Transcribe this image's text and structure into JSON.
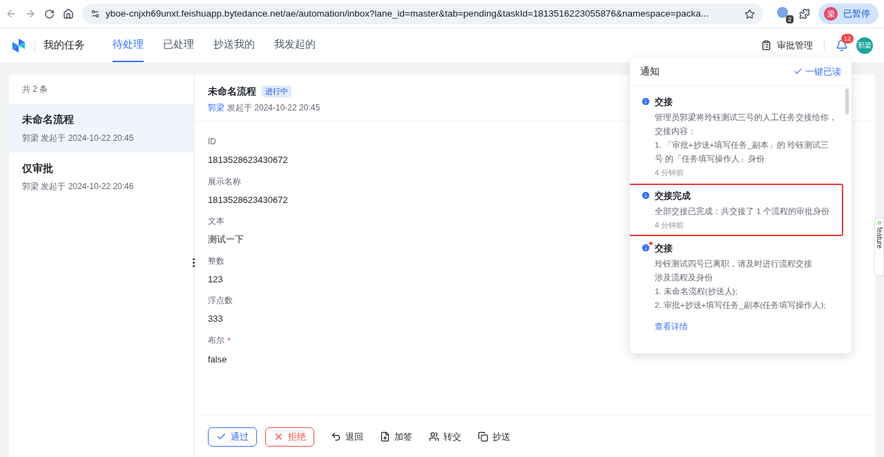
{
  "browser": {
    "url": "yboe-cnjxh69unxt.feishuapp.bytedance.net/ae/automation/inbox?lane_id=master&tab=pending&taskId=1813516223055876&namespace=packa...",
    "extension_badge": "2",
    "profile_avatar": "梁",
    "profile_label": "已暂停"
  },
  "header": {
    "title": "我的任务",
    "tabs": [
      {
        "label": "待处理",
        "selected": true
      },
      {
        "label": "已处理",
        "selected": false
      },
      {
        "label": "抄送我的",
        "selected": false
      },
      {
        "label": "我发起的",
        "selected": false
      }
    ],
    "admin_link": "审批管理",
    "notification_count": "12",
    "avatar": "郭梁"
  },
  "task_list": {
    "count": "共 2 条",
    "items": [
      {
        "title": "未命名流程",
        "meta": "郭梁 发起于 2024-10-22 20:45",
        "selected": true
      },
      {
        "title": "仅审批",
        "meta": "郭梁 发起于 2024-10-22 20:46",
        "selected": false
      }
    ]
  },
  "detail": {
    "title": "未命名流程",
    "status": "进行中",
    "initiator": "郭梁",
    "started": "发起于 2024-10-22 20:45",
    "fields": [
      {
        "label": "ID",
        "value": "1813528623430672"
      },
      {
        "label": "展示名称",
        "value": "1813528623430672"
      },
      {
        "label": "文本",
        "value": "测试一下"
      },
      {
        "label": "整数",
        "value": "123"
      },
      {
        "label": "浮点数",
        "value": "333"
      },
      {
        "label": "布尔",
        "value": "false",
        "required_mark": "*"
      }
    ],
    "actions": [
      {
        "kind": "approve",
        "label": "通过"
      },
      {
        "kind": "reject",
        "label": "拒绝"
      },
      {
        "kind": "return",
        "label": "退回"
      },
      {
        "kind": "addsign",
        "label": "加签"
      },
      {
        "kind": "transfer",
        "label": "转交"
      },
      {
        "kind": "cc",
        "label": "抄送"
      }
    ]
  },
  "notifications": {
    "title": "通知",
    "mark_all_read": "一键已读",
    "items": [
      {
        "title": "交接",
        "lines": [
          "管理员郭梁将玲钰测试三号的人工任务交接给你，",
          "交接内容：",
          "1. 「审批+抄送+填写任务_副本」的 玲钰测试三",
          "号 的「任务填写操作人」身份"
        ],
        "time": "4 分钟前",
        "unread": false,
        "highlighted": false
      },
      {
        "title": "交接完成",
        "lines": [
          "全部交接已完成：共交接了 1 个流程的审批身份"
        ],
        "time": "4 分钟前",
        "unread": false,
        "highlighted": true
      },
      {
        "title": "交接",
        "lines": [
          "玲钰测试四号已离职，请及时进行流程交接",
          "涉及流程及身份",
          "1. 未命名流程(抄送人);",
          "2. 审批+抄送+填写任务_副本(任务填写操作人);"
        ],
        "link": "查看详情",
        "unread": true,
        "highlighted": false
      }
    ]
  },
  "side_tab": {
    "label": "feature"
  }
}
